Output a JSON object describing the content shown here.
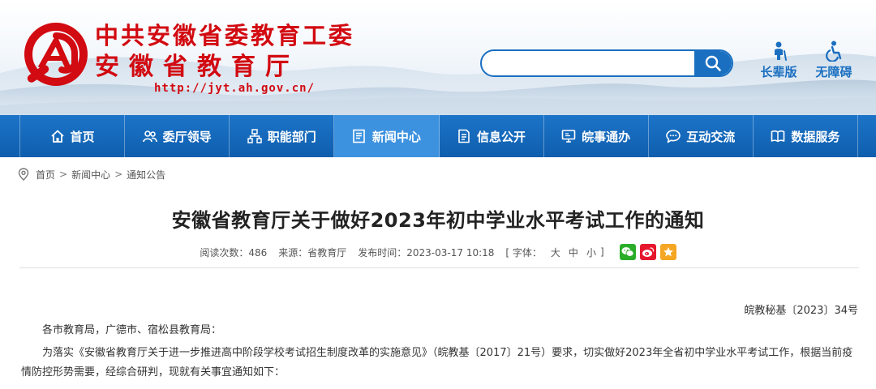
{
  "header": {
    "title_line1": "中共安徽省委教育工委",
    "title_line2": "安徽省教育厅",
    "url": "http://jyt.ah.gov.cn/",
    "search_placeholder": "",
    "tools": [
      {
        "label": "长辈版",
        "icon": "elderly-icon"
      },
      {
        "label": "无障碍",
        "icon": "wheelchair-icon"
      }
    ]
  },
  "nav": {
    "items": [
      {
        "label": "首页",
        "icon": "home-icon"
      },
      {
        "label": "委厅领导",
        "icon": "leaders-icon"
      },
      {
        "label": "职能部门",
        "icon": "org-chart-icon"
      },
      {
        "label": "新闻中心",
        "icon": "news-icon",
        "active": true
      },
      {
        "label": "信息公开",
        "icon": "document-icon"
      },
      {
        "label": "皖事通办",
        "icon": "monitor-icon"
      },
      {
        "label": "互动交流",
        "icon": "chat-icon"
      },
      {
        "label": "数据服务",
        "icon": "book-icon"
      }
    ]
  },
  "breadcrumb": {
    "home": "首页",
    "section": "新闻中心",
    "current": "通知公告",
    "separator": ">"
  },
  "article": {
    "title": "安徽省教育厅关于做好2023年初中学业水平考试工作的通知",
    "meta": {
      "views": "阅读次数：486",
      "source": "来源：省教育厅",
      "published": "发布时间：2023-03-17 10:18",
      "font_prefix": "[ 字体：",
      "font_large": "大",
      "font_medium": "中",
      "font_small": "小",
      "font_suffix": "]"
    },
    "share": [
      {
        "name": "wechat",
        "color": "#2aae2a"
      },
      {
        "name": "weibo",
        "color": "#e6162d"
      },
      {
        "name": "favorite",
        "color": "#f5a623"
      }
    ],
    "doc_number": "皖教秘基〔2023〕34号",
    "recipients": "各市教育局，广德市、宿松县教育局：",
    "body": "为落实《安徽省教育厅关于进一步推进高中阶段学校考试招生制度改革的实施意见》（皖教基〔2017〕21号）要求，切实做好2023年全省初中学业水平考试工作，根据当前疫情防控形势需要，经综合研判，现就有关事宜通知如下："
  },
  "colors": {
    "brand_red": "#d20a11",
    "nav_blue": "#1467b9",
    "nav_active": "#3d92e0"
  }
}
